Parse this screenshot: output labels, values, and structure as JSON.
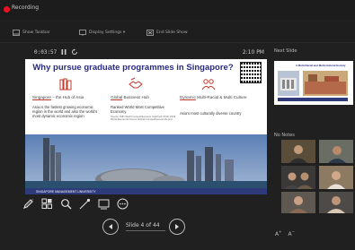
{
  "app": {
    "recording_label": "Recording"
  },
  "toolbar": {
    "items": [
      {
        "label": "Show Taskbar",
        "icon": "taskbar-icon"
      },
      {
        "label": "Display Settings ▾",
        "icon": "display-settings-icon"
      },
      {
        "label": "End Slide Show",
        "icon": "end-show-icon"
      }
    ]
  },
  "presenter": {
    "elapsed": "0:03:57",
    "clock": "2:10 PM"
  },
  "slide": {
    "title": "Why pursue graduate programmes in Singapore?",
    "columns": [
      {
        "heading_prefix": "Singapore",
        "heading_rest": " – the Hub of Asia",
        "body": "Asia is the fastest growing economic region in the world and also the world's most dynamic economic region"
      },
      {
        "heading_prefix": "Global",
        "heading_rest": " Business Hub",
        "body": "Ranked World Most Competitive Economy",
        "footnote": "Source: IMD World Competitiveness Yearbook 2019; 2019 World Economic Forum Global Competitiveness Report"
      },
      {
        "heading_prefix": "Dynamic",
        "heading_rest": " Multi-Racial & Multi Culture",
        "body": "Asia's most culturally diverse country"
      }
    ],
    "footer_logo": "SINGAPORE MANAGEMENT UNIVERSITY"
  },
  "navigation": {
    "slide_position": "Slide 4 of 44"
  },
  "side_panel": {
    "next_slide_label": "Next Slide",
    "notes_label": "No Notes",
    "next_thumb_title": "A Multi-Racial and Multi-Cultural Society"
  },
  "colors": {
    "background": "#202020",
    "slide_title": "#2a2a82",
    "accent_red": "#c0392b",
    "record_red": "#e81123"
  }
}
